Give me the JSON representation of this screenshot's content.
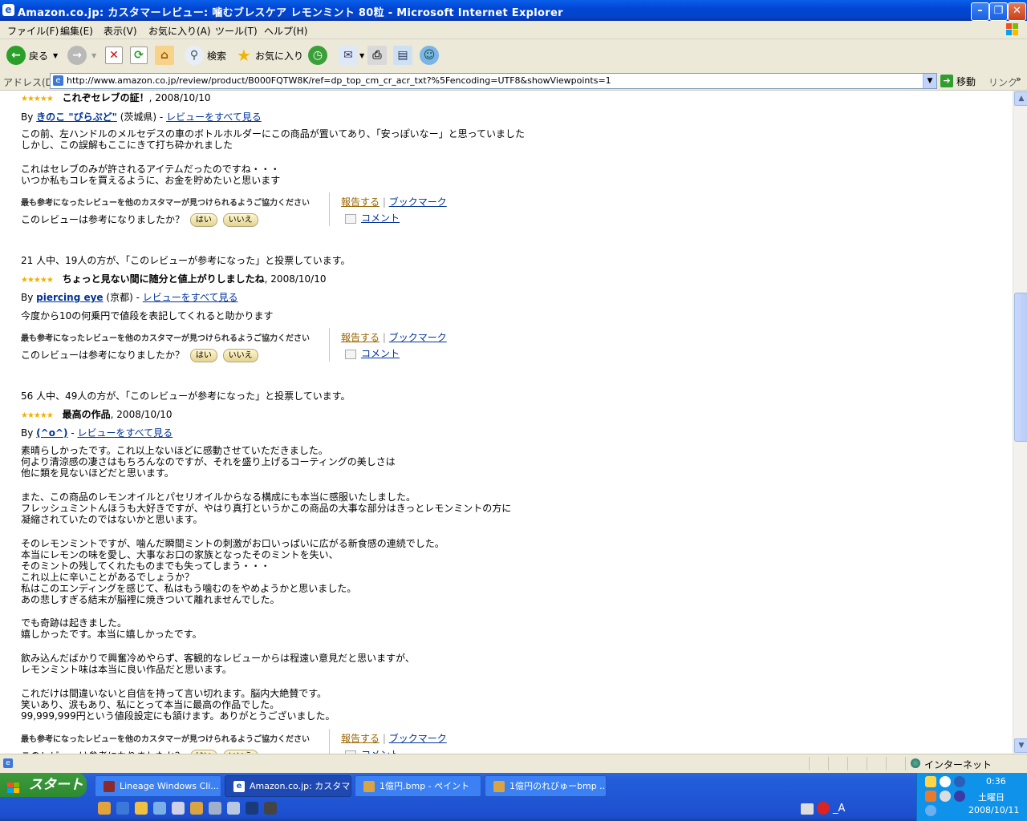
{
  "window": {
    "title": "Amazon.co.jp: カスタマーレビュー: 噛むブレスケア レモンミント 80粒 - Microsoft Internet Explorer"
  },
  "menu": [
    "ファイル(F)",
    "編集(E)",
    "表示(V)",
    "お気に入り(A)",
    "ツール(T)",
    "ヘルプ(H)"
  ],
  "toolbar": {
    "back": "戻る",
    "search": "検索",
    "favorites": "お気に入り"
  },
  "address": {
    "label": "アドレス(D)",
    "url": "http://www.amazon.co.jp/review/product/B000FQTW8K/ref=dp_top_cm_cr_acr_txt?%5Fencoding=UTF8&showViewpoints=1",
    "go": "移動",
    "links": "リンク"
  },
  "ui_text": {
    "by": "By",
    "dash": "-",
    "see_all": "レビューをすべて見る",
    "help_hint": "最も参考になったレビューを他のカスタマーが見つけられるようご協力ください",
    "helpful_q": "このレビューは参考になりましたか？",
    "yes": "はい",
    "no": "いいえ",
    "report": "報告する",
    "sep": "|",
    "bookmark": "ブックマーク",
    "comment": "コメント",
    "stars": "★★★★★"
  },
  "reviews": [
    {
      "title": "これぞセレブの証！",
      "date": ", 2008/10/10",
      "author": "きのこ \"ぴらぷど\"",
      "location": "(茨城県)",
      "body": [
        "この前、左ハンドルのメルセデスの車のボトルホルダーにこの商品が置いてあり、「安っぽいなー」と思っていました",
        "しかし、この誤解もここにきて打ち砕かれました",
        "",
        "これはセレブのみが許されるアイテムだったのですね・・・",
        "いつか私もコレを買えるように、お金を貯めたいと思います"
      ]
    },
    {
      "votes": "21 人中、19人の方が、「このレビューが参考になった」と投票しています。",
      "title": "ちょっと見ない間に随分と値上がりしましたね",
      "date": ", 2008/10/10",
      "author": "piercing eye",
      "location": "(京都)",
      "body": [
        "今度から10の何乗円で値段を表記してくれると助かります"
      ]
    },
    {
      "votes": "56 人中、49人の方が、「このレビューが参考になった」と投票しています。",
      "title": "最高の作品",
      "date": ", 2008/10/10",
      "author": "(^o^)",
      "location": "",
      "body": [
        "素晴らしかったです。これ以上ないほどに感動させていただきました。",
        "何より清涼感の凄さはもちろんなのですが、それを盛り上げるコーティングの美しさは",
        "他に類を見ないほどだと思います。",
        "",
        "また、この商品のレモンオイルとパセリオイルからなる構成にも本当に感服いたしました。",
        "フレッシュミントんほうも大好きですが、やはり真打というかこの商品の大事な部分はきっとレモンミントの方に",
        "凝縮されていたのではないかと思います。",
        "",
        "そのレモンミントですが、噛んだ瞬間ミントの刺激がお口いっぱいに広がる新食感の連続でした。",
        "本当にレモンの味を愛し、大事なお口の家族となったそのミントを失い、",
        "そのミントの残してくれたものまでも失ってしまう・・・",
        "これ以上に辛いことがあるでしょうか？",
        "私はこのエンディングを感じて、私はもう噛むのをやめようかと思いました。",
        "あの悲しすぎる結末が脳裡に焼きついて離れませんでした。",
        "",
        "でも奇跡は起きました。",
        "嬉しかったです。本当に嬉しかったです。",
        "",
        "飲み込んだばかりで興奮冷めやらず、客観的なレビューからは程遠い意見だと思いますが、",
        "レモンミント味は本当に良い作品だと思います。",
        "",
        "これだけは間違いないと自信を持って言い切れます。脳内大絶賛です。",
        "笑いあり、涙もあり、私にとって本当に最高の作品でした。",
        "99,999,999円という値段設定にも頷けます。ありがとうございました。"
      ]
    }
  ],
  "status": {
    "zone": "インターネット"
  },
  "taskbar": {
    "start": "スタート",
    "tasks": [
      "Lineage Windows Cli...",
      "Amazon.co.jp: カスタマ...",
      "1億円.bmp - ペイント",
      "1億円のれびゅーbmp ..."
    ],
    "time": "0:36",
    "day": "土曜日",
    "date": "2008/10/11",
    "ime": "_A"
  },
  "colors": {
    "link": "#003399",
    "report_link": "#996600",
    "stars": "#f0b000",
    "titlebar": "#0046d5"
  }
}
